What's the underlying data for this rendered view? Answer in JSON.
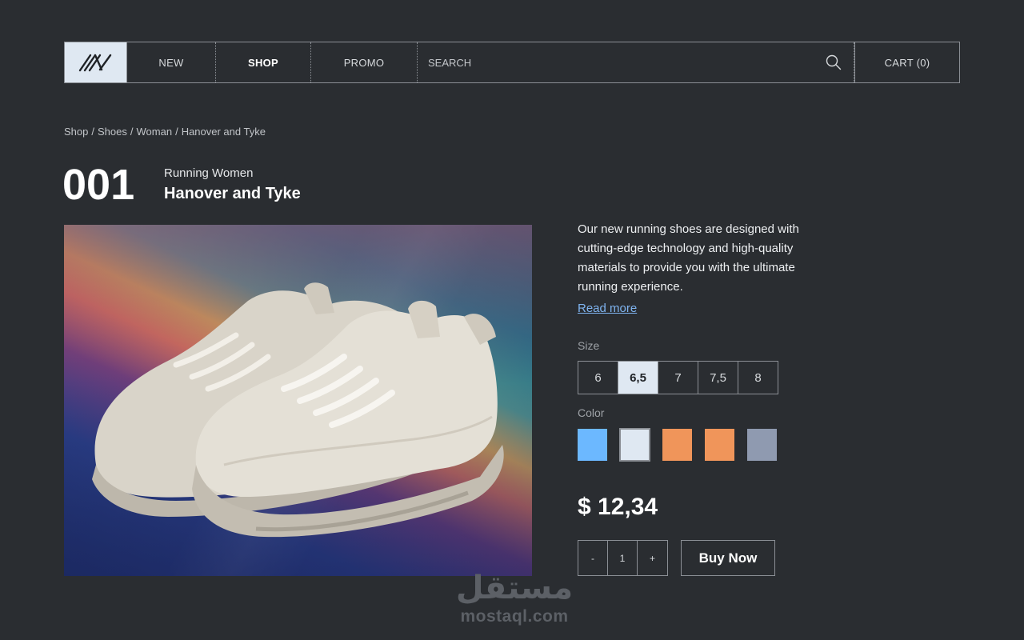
{
  "nav": {
    "logo_icon": "brand-logo-icon",
    "items": [
      {
        "label": "NEW"
      },
      {
        "label": "SHOP"
      },
      {
        "label": "PROMO"
      }
    ],
    "search_placeholder": "SEARCH",
    "cart_label": "CART (0)"
  },
  "breadcrumb": [
    "Shop",
    "Shoes",
    "Woman",
    "Hanover and Tyke"
  ],
  "product": {
    "number": "001",
    "category": "Running Women",
    "name": "Hanover and Tyke",
    "description": "Our new running shoes are designed with cutting-edge technology and high-quality materials to provide you with the ultimate running experience.",
    "read_more": "Read more",
    "size_label": "Size",
    "sizes": [
      "6",
      "6,5",
      "7",
      "7,5",
      "8"
    ],
    "selected_size": "6,5",
    "color_label": "Color",
    "colors": [
      "#6cb8ff",
      "#dfe8f2",
      "#f0955a",
      "#f0955a",
      "#8f9ab0"
    ],
    "selected_color_index": 1,
    "price": "$ 12,34",
    "quantity": {
      "minus": "-",
      "value": "1",
      "plus": "+"
    },
    "buy_label": "Buy Now"
  },
  "watermark": {
    "arabic": "مستقل",
    "latin": "mostaql.com"
  },
  "colors": {
    "background": "#2a2d31",
    "accent": "#dfe8f2",
    "link": "#7fb4f0"
  }
}
